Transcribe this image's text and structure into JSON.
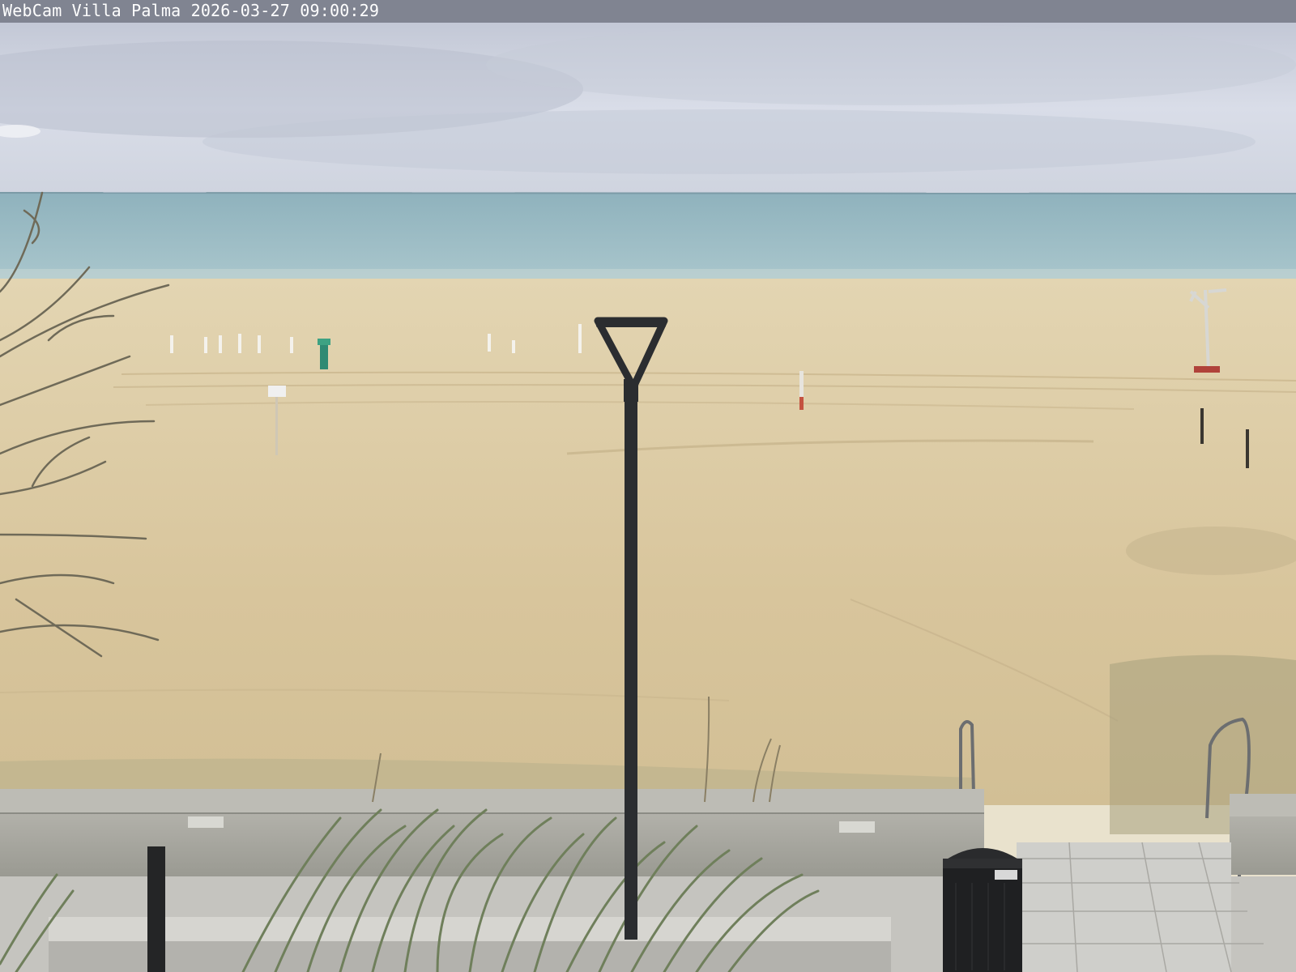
{
  "overlay": {
    "camera_label": "WebCam Villa Palma 2026-03-27 09:00:29"
  },
  "scene": {
    "icons": [
      "cloudy-sky",
      "sea",
      "sandy-beach",
      "street-lamp",
      "bare-tree",
      "grass-tuft",
      "trash-bin",
      "stair-railing",
      "bollard",
      "concrete-wall",
      "paved-walkway"
    ],
    "colors": {
      "sky": "#cdd2df",
      "sea": "#9fc0c8",
      "sand": "#d9c8a0",
      "wall": "#a8a8a0",
      "lamp": "#2b2d30",
      "grass": "#7f8d6a",
      "pavement": "#c7c6c2"
    }
  }
}
